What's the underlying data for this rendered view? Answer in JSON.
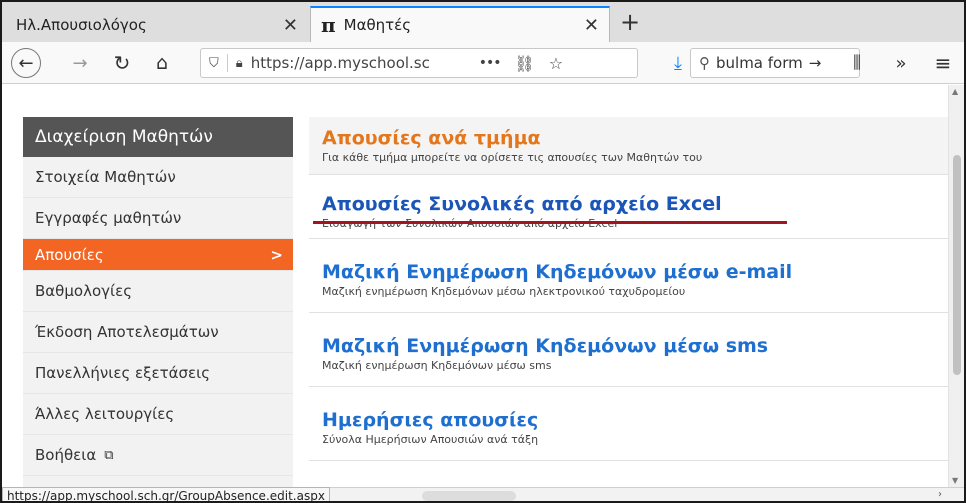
{
  "browser": {
    "tabs": [
      {
        "label": "Ηλ.Απουσιολόγος",
        "close": "✕"
      },
      {
        "icon": "π",
        "label": "Μαθητές",
        "close": "✕"
      }
    ],
    "new_tab": "+",
    "url": "https://app.myschool.sc",
    "search_text": "bulma form",
    "search_arrow": "→",
    "status_url": "https://app.myschool.sch.gr/GroupAbsence.edit.aspx"
  },
  "sidebar": {
    "header": "Διαχείριση Μαθητών",
    "items": [
      {
        "label": "Στοιχεία Μαθητών"
      },
      {
        "label": "Εγγραφές μαθητών"
      },
      {
        "label": "Απουσίες",
        "chevron": ">"
      },
      {
        "label": "Βαθμολογίες"
      },
      {
        "label": "Έκδοση Αποτελεσμάτων"
      },
      {
        "label": "Πανελλήνιες εξετάσεις"
      },
      {
        "label": "Άλλες λειτουργίες"
      },
      {
        "label": "Βοήθεια",
        "ext": "⧉"
      }
    ],
    "active_color": "#f26522"
  },
  "main": {
    "entries": [
      {
        "title": "Απουσίες ανά τμήμα",
        "desc": "Για κάθε τμήμα μπορείτε να ορίσετε τις απουσίες των Μαθητών του"
      },
      {
        "title": "Απουσίες Συνολικές από αρχείο Excel",
        "desc": "Εισαγωγή των Συνολικών Απουσιών από αρχείο Excel"
      },
      {
        "title": "Μαζική Ενημέρωση Κηδεμόνων μέσω e-mail",
        "desc": "Μαζική ενημέρωση Κηδεμόνων μέσω ηλεκτρονικού ταχυδρομείου"
      },
      {
        "title": "Μαζική Ενημέρωση Κηδεμόνων μέσω sms",
        "desc": "Μαζική ενημέρωση Κηδεμόνων μέσω sms"
      },
      {
        "title": "Ημερήσιες απουσίες",
        "desc": "Σύνολα Ημερήσιων Απουσιών ανά τάξη"
      }
    ],
    "link_color": "#1e6fcf",
    "header_color": "#e4761b",
    "underline_color": "#a0151f"
  }
}
